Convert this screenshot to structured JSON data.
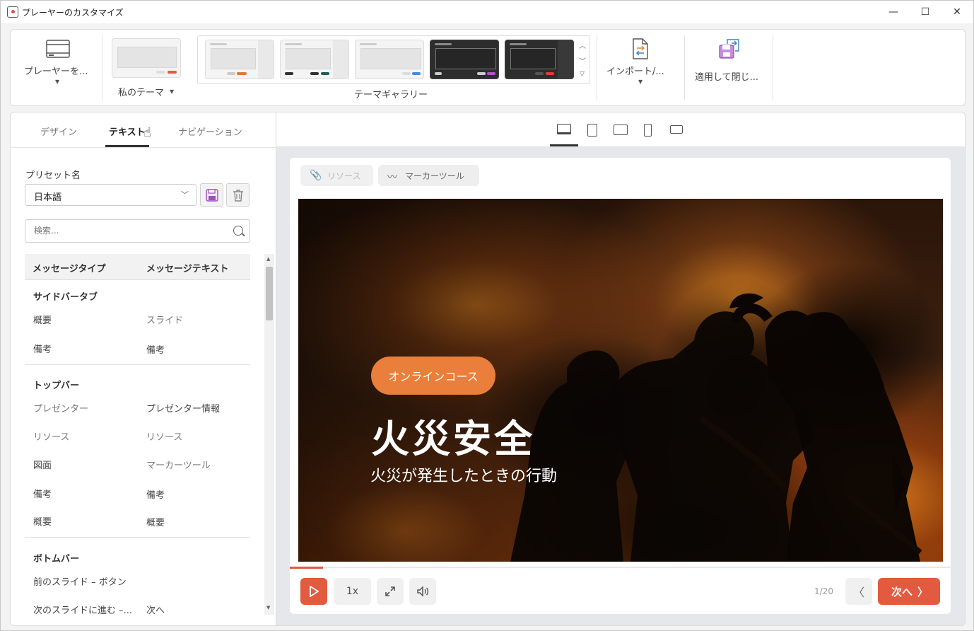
{
  "window": {
    "title": "プレーヤーのカスタマイズ",
    "minimize": "—",
    "maximize": "☐",
    "close": "✕"
  },
  "ribbon": {
    "player_label": "プレーヤーを...",
    "my_theme_label": "私のテーマ",
    "gallery_label": "テーマギャラリー",
    "import_label": "インポート/...",
    "apply_label": "適用して閉じ..."
  },
  "tabs": {
    "design": "デザイン",
    "text": "テキスト",
    "navigation": "ナビゲーション"
  },
  "preset": {
    "label": "プリセット名",
    "value": "日本語",
    "search_placeholder": "検索..."
  },
  "table": {
    "col_type": "メッセージタイプ",
    "col_text": "メッセージテキスト",
    "sections": [
      {
        "title": "サイドバータブ",
        "rows": [
          {
            "type": "概要",
            "text": "スライド"
          },
          {
            "type": "備考",
            "text": "備考"
          }
        ]
      },
      {
        "title": "トップバー",
        "rows": [
          {
            "type": "プレゼンター",
            "text": "プレゼンター情報"
          },
          {
            "type": "リソース",
            "text": "リソース"
          },
          {
            "type": "図面",
            "text": "マーカーツール"
          },
          {
            "type": "備考",
            "text": "備考"
          },
          {
            "type": "概要",
            "text": "概要"
          }
        ]
      },
      {
        "title": "ボトムバー",
        "rows": [
          {
            "type": "前のスライド – ボタン",
            "text": ""
          },
          {
            "type": "次のスライドに進む –...",
            "text": "次へ"
          }
        ]
      }
    ]
  },
  "player": {
    "resources_label": "リソース",
    "marker_label": "マーカーツール",
    "badge": "オンラインコース",
    "title": "火災安全",
    "subtitle": "火災が発生したときの行動",
    "speed": "1x",
    "page": "1/20",
    "next": "次へ",
    "progress_fraction": 0.05
  },
  "colors": {
    "accent": "#e25a40",
    "badge": "#e97f3a"
  }
}
